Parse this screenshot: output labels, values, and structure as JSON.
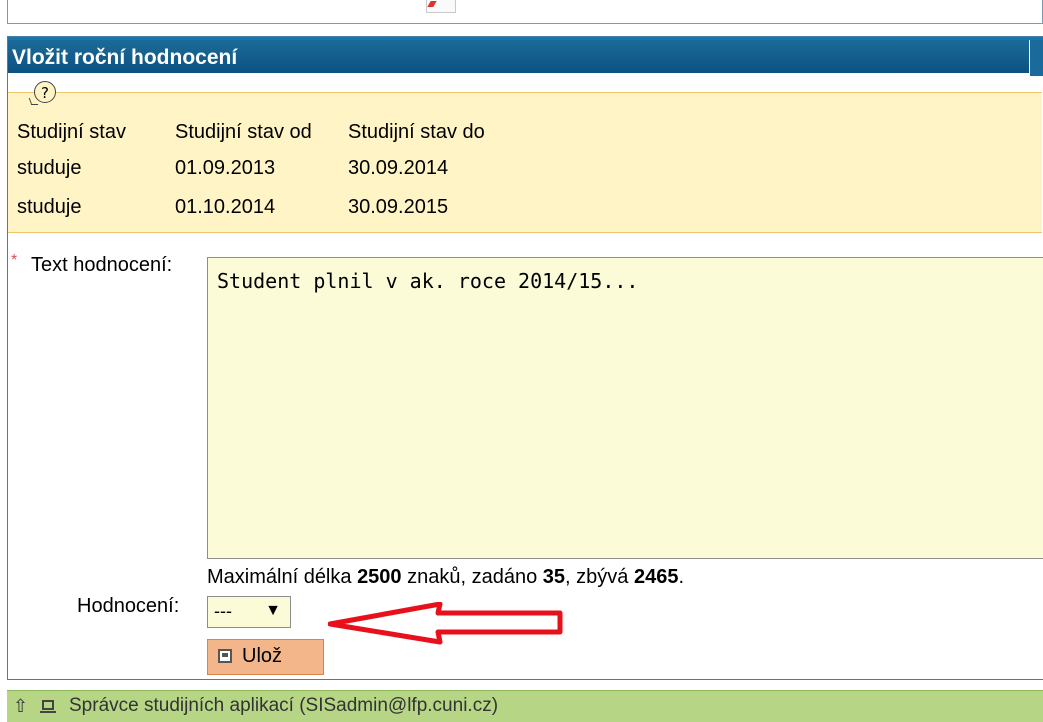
{
  "panel": {
    "title": "Vložit roční hodnocení"
  },
  "study_status": {
    "columns": [
      "Studijní stav",
      "Studijní stav od",
      "Studijní stav do"
    ],
    "rows": [
      [
        "studuje",
        "01.09.2013",
        "30.09.2014"
      ],
      [
        "studuje",
        "01.10.2014",
        "30.09.2015"
      ]
    ]
  },
  "form": {
    "required_mark": "*",
    "text_label": "Text hodnocení:",
    "text_value": "Student plnil v ak. roce 2014/15...",
    "counter": {
      "prefix": "Maximální délka ",
      "max": "2500",
      "mid1": " znaků, zadáno ",
      "entered": "35",
      "mid2": ", zbývá ",
      "remaining": "2465",
      "suffix": "."
    },
    "rating_label": "Hodnocení:",
    "rating_value": "---",
    "save_label": "Ulož"
  },
  "footer": {
    "text": "Správce studijních aplikací (SISadmin@lfp.cuni.cz)"
  },
  "colors": {
    "header_bg": "#0c5282",
    "info_bg": "#fff4c5",
    "input_bg": "#fbfbd8",
    "button_bg": "#f3b58a",
    "footer_bg": "#b6d686",
    "annotation": "#e8101a"
  },
  "icons": {
    "help": "help-bubble-icon",
    "save": "save-icon",
    "footer_up": "up-arrow-icon",
    "footer_admin": "monitor-icon"
  }
}
